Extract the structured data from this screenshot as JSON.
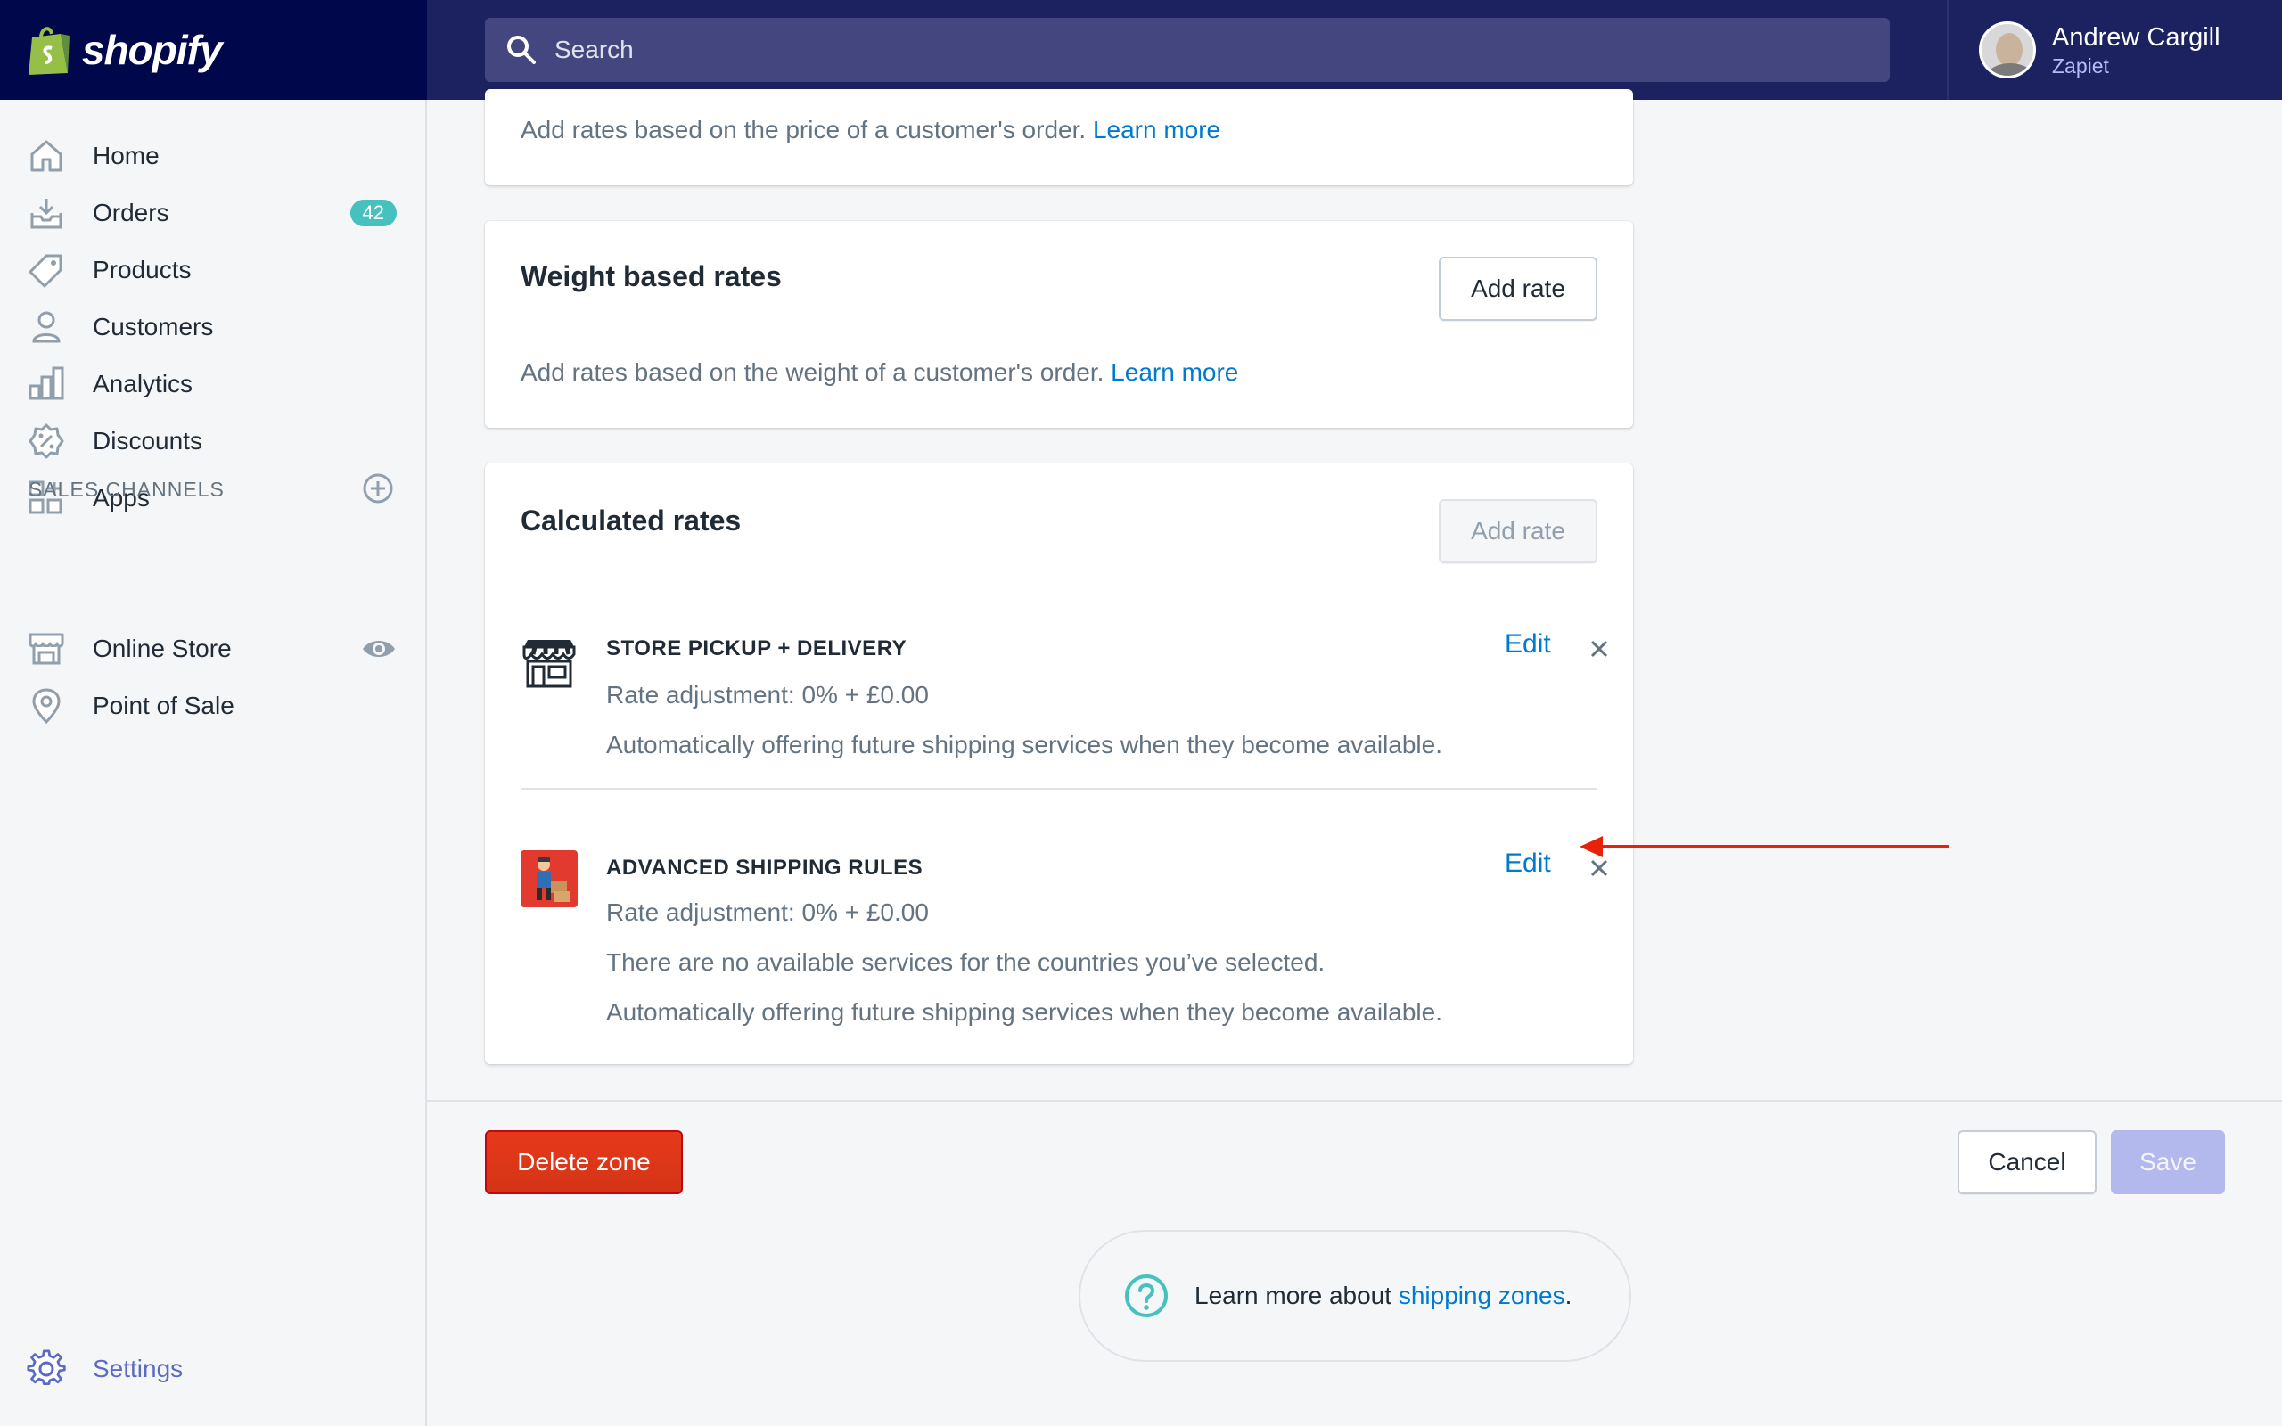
{
  "brand": {
    "name": "shopify"
  },
  "search": {
    "placeholder": "Search"
  },
  "user": {
    "name": "Andrew Cargill",
    "org": "Zapiet"
  },
  "sidebar": {
    "items": [
      {
        "label": "Home",
        "icon": "home-icon"
      },
      {
        "label": "Orders",
        "icon": "orders-icon",
        "badge": "42"
      },
      {
        "label": "Products",
        "icon": "tag-icon"
      },
      {
        "label": "Customers",
        "icon": "person-icon"
      },
      {
        "label": "Analytics",
        "icon": "bar-chart-icon"
      },
      {
        "label": "Discounts",
        "icon": "discount-icon"
      },
      {
        "label": "Apps",
        "icon": "apps-icon"
      }
    ],
    "sales_channels_title": "SALES CHANNELS",
    "channels": [
      {
        "label": "Online Store",
        "icon": "store-icon"
      },
      {
        "label": "Point of Sale",
        "icon": "location-pin-icon"
      }
    ],
    "settings_label": "Settings"
  },
  "price_card": {
    "desc": "Add rates based on the price of a customer's order.",
    "link": "Learn more"
  },
  "weight_card": {
    "title": "Weight based rates",
    "add_rate": "Add rate",
    "desc": "Add rates based on the weight of a customer's order.",
    "link": "Learn more"
  },
  "calculated_card": {
    "title": "Calculated rates",
    "add_rate": "Add rate",
    "rates": [
      {
        "name": "STORE PICKUP + DELIVERY",
        "edit": "Edit",
        "adjustment": "Rate adjustment: 0% + £0.00",
        "note1": "Automatically offering future shipping services when they become available."
      },
      {
        "name": "ADVANCED SHIPPING RULES",
        "edit": "Edit",
        "adjustment": "Rate adjustment: 0% + £0.00",
        "note1": "There are no available services for the countries you’ve selected.",
        "note2": "Automatically offering future shipping services when they become available."
      }
    ]
  },
  "footer": {
    "delete": "Delete zone",
    "cancel": "Cancel",
    "save": "Save"
  },
  "help": {
    "prefix": "Learn more about",
    "link": "shipping zones",
    "suffix": "."
  },
  "colors": {
    "topbar": "#1c2260",
    "logo_bg": "#00074a",
    "link": "#007ace",
    "danger": "#de3618",
    "badge": "#47c1bf",
    "annotation_arrow": "#e8220a"
  }
}
